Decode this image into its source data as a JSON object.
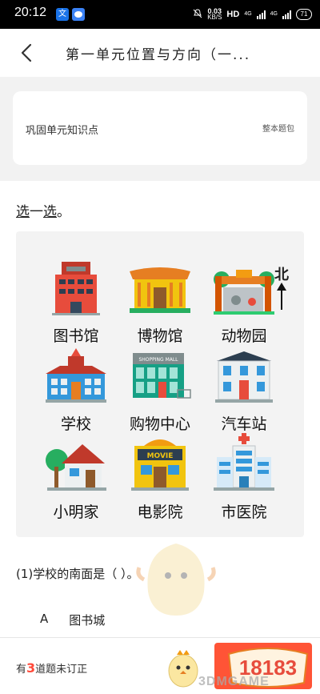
{
  "status_bar": {
    "time": "20:12",
    "app_icon_1": "文",
    "speed_value": "0.03",
    "speed_unit": "KB/S",
    "hd": "HD",
    "net1": "4G",
    "net2": "4G",
    "battery": "71"
  },
  "header": {
    "title": "第一单元位置与方向（一..."
  },
  "info_card": {
    "title": "巩固单元知识点",
    "link": "整本题包"
  },
  "question": {
    "instruction_part1": "选",
    "instruction_part2": "一",
    "instruction_part3": "选",
    "instruction_end": "。",
    "north_label": "北",
    "places": [
      {
        "label": "图书馆"
      },
      {
        "label": "博物馆"
      },
      {
        "label": "动物园"
      },
      {
        "label": "学校"
      },
      {
        "label": "购物中心"
      },
      {
        "label": "汽车站"
      },
      {
        "label": "小明家"
      },
      {
        "label": "电影院"
      },
      {
        "label": "市医院"
      }
    ],
    "mall_sign": "SHOPPING MALL",
    "movie_sign": "MOVIE",
    "zoo_sign": "ZOO",
    "text": "(1)学校的南面是（ ）。",
    "option_letter": "A",
    "option_text": "图书城"
  },
  "bottom_bar": {
    "prefix": "有",
    "count": "3",
    "suffix": "道题未订正",
    "watermark": "3DMGAME",
    "logo_text": "18183"
  },
  "colors": {
    "accent_red": "#ff5436",
    "count_red": "#ff4a3a"
  }
}
